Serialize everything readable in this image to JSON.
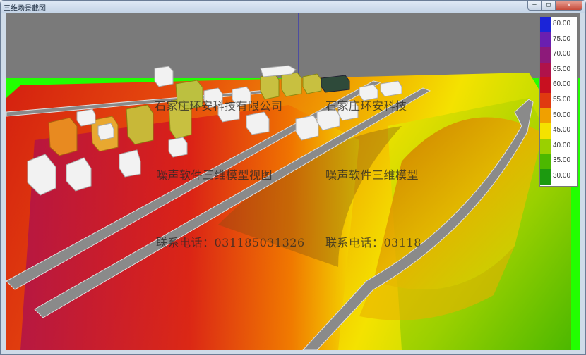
{
  "window": {
    "title": "三维场景截图",
    "buttons": {
      "minimize": "–",
      "maximize": "□",
      "close": "x"
    }
  },
  "watermarks": [
    {
      "text": "石家庄环安科技有限公司"
    },
    {
      "text": "石家庄环安科技"
    },
    {
      "text": "噪声软件三维模型视图"
    },
    {
      "text": "噪声软件三维模型"
    },
    {
      "text": "联系电话：031185031326"
    },
    {
      "text": "联系电话：03118"
    }
  ],
  "legend": {
    "items": [
      {
        "label": "80.00",
        "color": "#1b24d8"
      },
      {
        "label": "75.00",
        "color": "#6a1fb0"
      },
      {
        "label": "70.00",
        "color": "#8d1a7a"
      },
      {
        "label": "65.00",
        "color": "#b0124a"
      },
      {
        "label": "60.00",
        "color": "#c81020"
      },
      {
        "label": "55.00",
        "color": "#e03a10"
      },
      {
        "label": "50.00",
        "color": "#f0a000"
      },
      {
        "label": "45.00",
        "color": "#f4e200"
      },
      {
        "label": "40.00",
        "color": "#9ad000"
      },
      {
        "label": "35.00",
        "color": "#4cb800"
      },
      {
        "label": "30.00",
        "color": "#1c9a10"
      }
    ]
  },
  "colors": {
    "sky": "#7a7a7a",
    "ground_edge": "#22ff00"
  }
}
